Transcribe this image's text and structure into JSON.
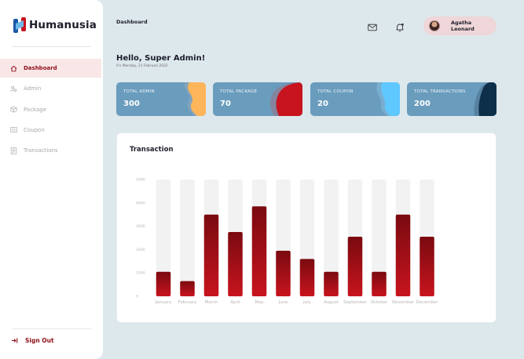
{
  "brand": {
    "name": "Humanusia"
  },
  "sidebar": {
    "items": [
      {
        "label": "Dashboard",
        "icon": "home-icon",
        "active": true
      },
      {
        "label": "Admin",
        "icon": "admin-users-icon",
        "active": false
      },
      {
        "label": "Package",
        "icon": "package-box-icon",
        "active": false
      },
      {
        "label": "Coupon",
        "icon": "coupon-icon",
        "active": false
      },
      {
        "label": "Transactions",
        "icon": "transactions-icon",
        "active": false
      }
    ],
    "signout": "Sign Out"
  },
  "header": {
    "breadcrumb": "Dashboard",
    "user_name": "Agatha Leonard"
  },
  "greeting": {
    "title": "Hello, Super Admin!",
    "date": "it's Monday, 21 Februari 2022"
  },
  "stats": [
    {
      "label": "TOTAL ADMIN",
      "value": "300",
      "color": "#6a9cbd",
      "accent": "#ffb55a"
    },
    {
      "label": "TOTAL PACKAGE",
      "value": "70",
      "color": "#6a9cbd",
      "accent": "#c8141e"
    },
    {
      "label": "TOTAL COUPON",
      "value": "20",
      "color": "#6a9cbd",
      "accent": "#5ec8ff"
    },
    {
      "label": "TOTAL TRANSACTIONS",
      "value": "200",
      "color": "#6a9cbd",
      "accent": "#0d2f4a"
    }
  ],
  "chart": {
    "title": "Transaction"
  },
  "chart_data": {
    "type": "bar",
    "title": "Transaction",
    "categories": [
      "January",
      "February",
      "March",
      "April",
      "May",
      "June",
      "July",
      "August",
      "September",
      "October",
      "November",
      "December"
    ],
    "values": [
      1050,
      650,
      3500,
      2750,
      3850,
      1950,
      1600,
      1050,
      2550,
      1050,
      3500,
      2550
    ],
    "ylim": [
      0,
      5000
    ],
    "yticks": [
      0,
      1000,
      2000,
      3000,
      4000,
      5000
    ],
    "grid": false,
    "bar_color": "#a3121b",
    "track_color": "#f2f2f2"
  }
}
